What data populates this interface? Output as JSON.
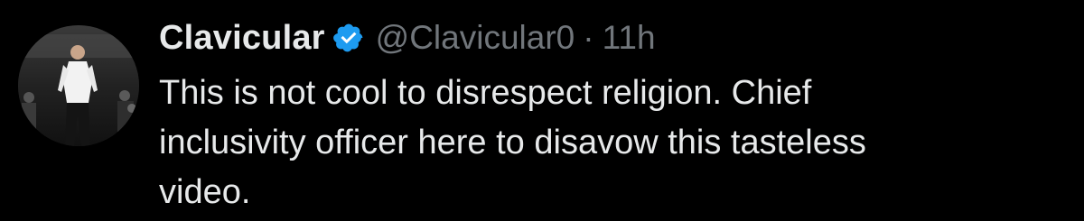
{
  "tweet": {
    "author": {
      "display_name": "Clavicular",
      "handle": "@Clavicular0",
      "verified": true,
      "avatar_icon": "avatar-photo"
    },
    "separator": "·",
    "timestamp": "11h",
    "text": "This is not cool to disrespect religion. Chief inclusivity officer here to disavow this tasteless video."
  },
  "colors": {
    "background": "#000000",
    "primary_text": "#e7e9ea",
    "secondary_text": "#71767b",
    "verified_badge": "#1d9bf0"
  }
}
